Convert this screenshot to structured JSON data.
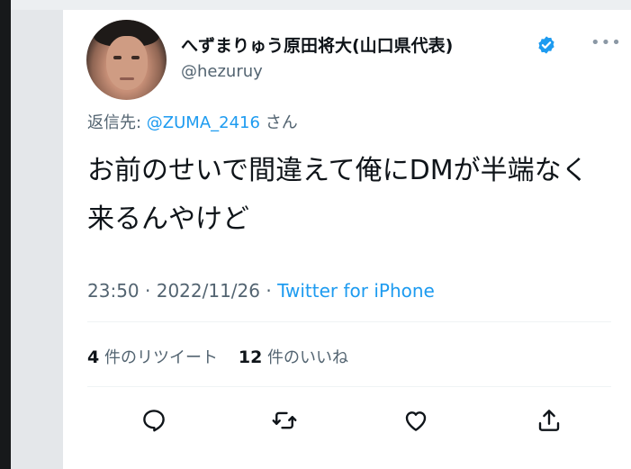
{
  "tweet": {
    "display_name": "へずまりゅう原田将大(山口県代表)",
    "handle": "@hezuruy",
    "reply_prefix": "返信先: ",
    "reply_mention": "@ZUMA_2416",
    "reply_suffix": " さん",
    "text": "お前のせいで間違えて俺にDMが半端なく来るんやけど",
    "time": "23:50",
    "separator1": " · ",
    "date": "2022/11/26",
    "separator2": " · ",
    "source": "Twitter for iPhone",
    "retweet_count": "4",
    "retweet_label": "件のリツイート",
    "like_count": "12",
    "like_label": "件のいいね"
  },
  "icons": {
    "verified": "verified-badge-icon",
    "more": "more-dots-icon",
    "reply": "reply-icon",
    "retweet": "retweet-icon",
    "like": "heart-icon",
    "share": "share-icon"
  },
  "colors": {
    "accent": "#1d9bf0",
    "text_primary": "#0f1419",
    "text_secondary": "#536471",
    "verified": "#1d9bf0"
  }
}
